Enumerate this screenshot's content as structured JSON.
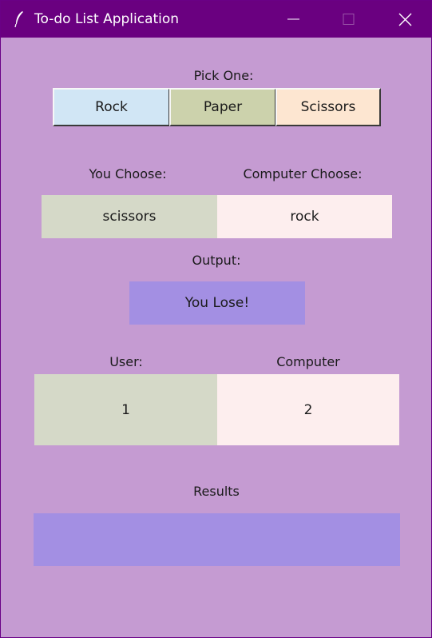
{
  "window": {
    "title": "To-do List Application"
  },
  "colors": {
    "titlebar": "#6a0080",
    "background": "#c59bd2",
    "rock": "#d1e6f5",
    "paper": "#ccd2ac",
    "scissors": "#fde6d1",
    "user_box": "#d5d9c8",
    "computer_box": "#fdeeee",
    "output_box": "#a38fe3",
    "results_box": "#a38fe3"
  },
  "pick": {
    "label": "Pick One:",
    "buttons": [
      "Rock",
      "Paper",
      "Scissors"
    ]
  },
  "choices": {
    "you_label": "You Choose:",
    "computer_label": "Computer Choose:",
    "you_value": "scissors",
    "computer_value": "rock"
  },
  "output": {
    "label": "Output:",
    "value": "You Lose!"
  },
  "score": {
    "user_label": "User:",
    "computer_label": "Computer",
    "user_value": "1",
    "computer_value": "2"
  },
  "results": {
    "label": "Results",
    "value": ""
  }
}
